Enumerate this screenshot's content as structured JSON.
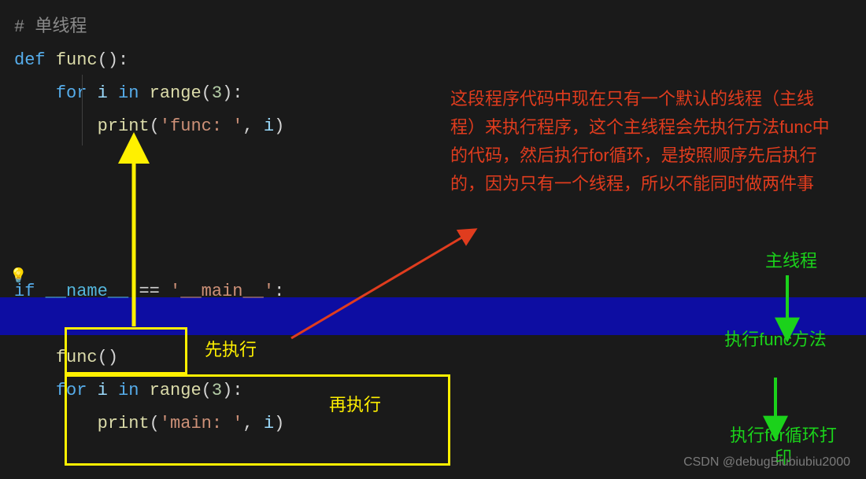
{
  "code": {
    "comment": "# 单线程",
    "l2_def": "def",
    "l2_fn": "func",
    "l2_pc": "():",
    "l3_for": "for",
    "l3_i": "i",
    "l3_in": "in",
    "l3_range": "range",
    "l3_open": "(",
    "l3_num": "3",
    "l3_close": "):",
    "l4_print": "print",
    "l4_open": "(",
    "l4_str": "'func: '",
    "l4_comma": ",",
    "l4_i": "i",
    "l4_close": ")",
    "l6_if": "if",
    "l6_name": "__name__",
    "l6_eq": "==",
    "l6_main": "'__main__'",
    "l6_colon": ":",
    "l7_func": "func",
    "l7_pc": "()",
    "l8_for": "for",
    "l8_i": "i",
    "l8_in": "in",
    "l8_range": "range",
    "l8_open": "(",
    "l8_num": "3",
    "l8_close": "):",
    "l9_print": "print",
    "l9_open": "(",
    "l9_str": "'main: '",
    "l9_comma": ",",
    "l9_i": "i",
    "l9_close": ")"
  },
  "annot": {
    "red": "这段程序代码中现在只有一个默认的线程（主线程）来执行程序，这个主线程会先执行方法func中的代码，然后执行for循环，是按照顺序先后执行的，因为只有一个线程，所以不能同时做两件事",
    "green1": "主线程",
    "green2": "执行func方法",
    "green3": "执行for循环打印",
    "yellow1": "先执行",
    "yellow2": "再执行"
  },
  "watermark": "CSDN @debugBiubiubiu2000",
  "bulb": "💡"
}
